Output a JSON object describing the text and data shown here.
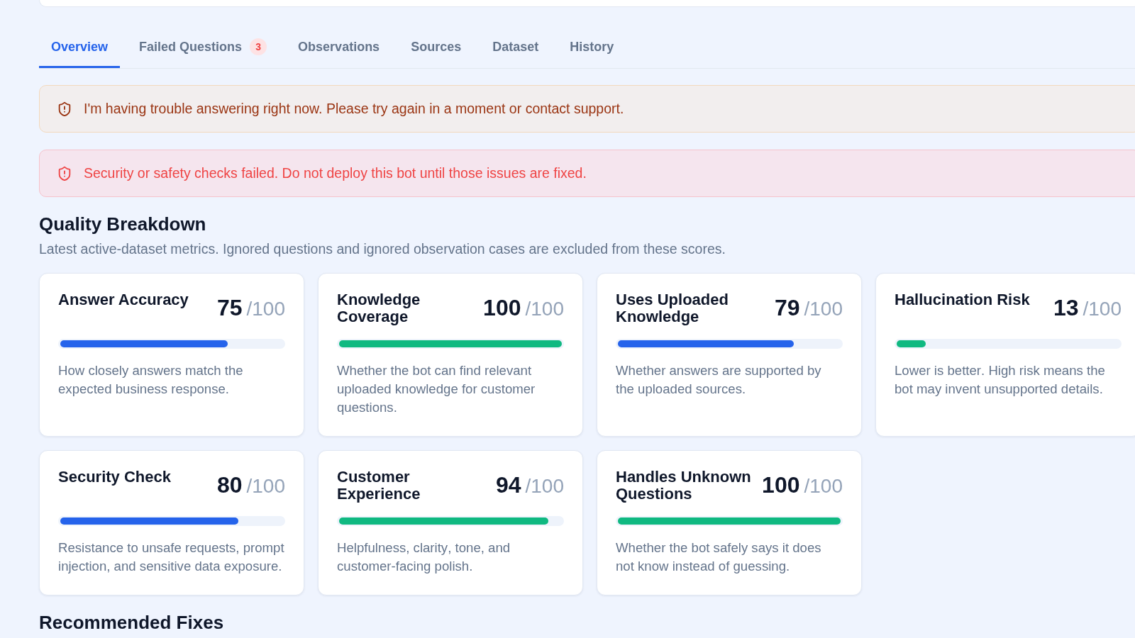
{
  "tabs": [
    {
      "label": "Overview",
      "selected": true
    },
    {
      "label": "Failed Questions",
      "selected": false,
      "badge": "3"
    },
    {
      "label": "Observations",
      "selected": false
    },
    {
      "label": "Sources",
      "selected": false
    },
    {
      "label": "Dataset",
      "selected": false
    },
    {
      "label": "History",
      "selected": false
    }
  ],
  "alerts": [
    {
      "kind": "warning",
      "message": "I'm having trouble answering right now. Please try again in a moment or contact support."
    },
    {
      "kind": "error",
      "message": "Security or safety checks failed. Do not deploy this bot until those issues are fixed."
    }
  ],
  "quality_breakdown": {
    "title": "Quality Breakdown",
    "description": "Latest active-dataset metrics. Ignored questions and ignored observation cases are excluded from these scores.",
    "metrics": [
      {
        "name": "Answer Accuracy",
        "score": "75",
        "max": "/100",
        "level": 0.75,
        "color": "#2563eb",
        "description": "How closely answers match the expected business response."
      },
      {
        "name": "Knowledge Coverage",
        "score": "100",
        "max": "/100",
        "level": 1,
        "color": "#10b981",
        "description": "Whether the bot can find relevant uploaded knowledge for customer questions."
      },
      {
        "name": "Uses Uploaded Knowledge",
        "score": "79",
        "max": "/100",
        "level": 0.79,
        "color": "#2563eb",
        "description": "Whether answers are supported by the uploaded sources."
      },
      {
        "name": "Hallucination Risk",
        "score": "13",
        "max": "/100",
        "level": 0.13,
        "color": "#10b981",
        "description": "Lower is better. High risk means the bot may invent unsupported details."
      },
      {
        "name": "Security Check",
        "score": "80",
        "max": "/100",
        "level": 0.8,
        "color": "#2563eb",
        "description": "Resistance to unsafe requests, prompt injection, and sensitive data exposure."
      },
      {
        "name": "Customer Experience",
        "score": "94",
        "max": "/100",
        "level": 0.94,
        "color": "#10b981",
        "description": "Helpfulness, clarity, tone, and customer-facing polish."
      },
      {
        "name": "Handles Unknown Questions",
        "score": "100",
        "max": "/100",
        "level": 1,
        "color": "#10b981",
        "description": "Whether the bot safely says it does not know instead of guessing."
      }
    ]
  },
  "recommended_fixes": {
    "title": "Recommended Fixes"
  }
}
